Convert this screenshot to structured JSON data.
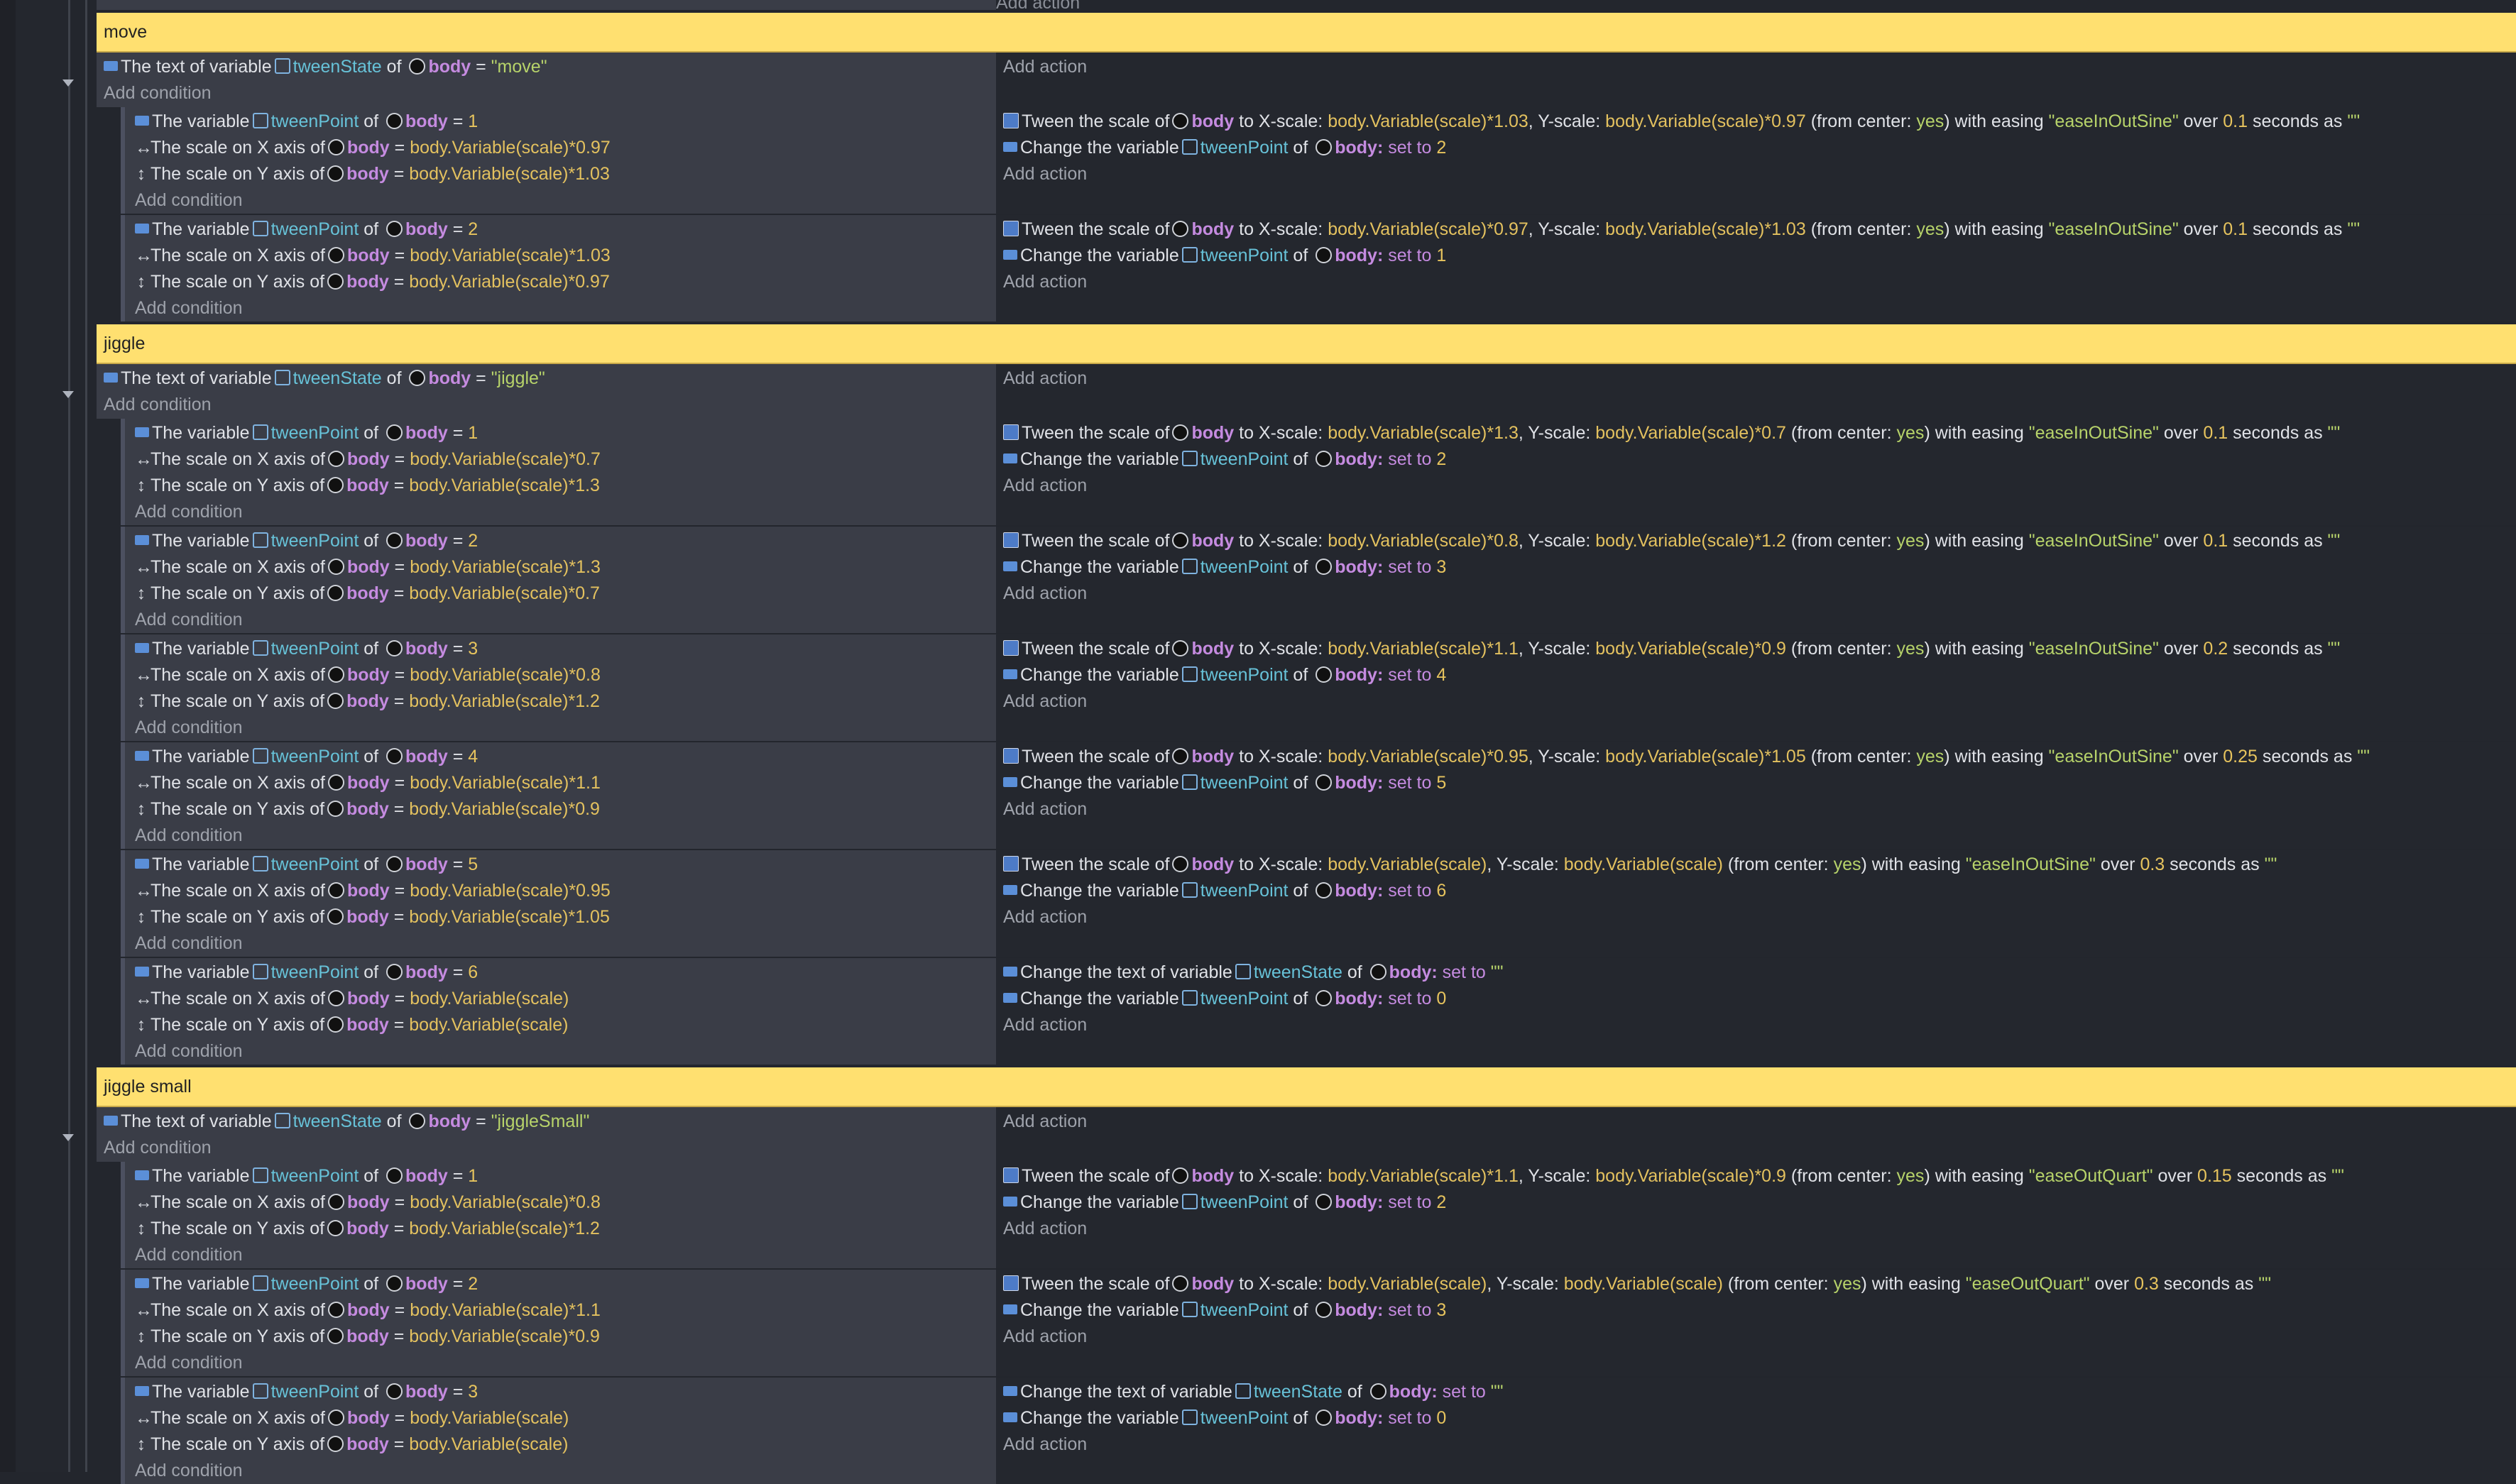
{
  "top_strip": {
    "add_action": "Add action"
  },
  "labels": {
    "add_condition": "Add condition",
    "add_action": "Add action",
    "the_variable": "The variable",
    "the_text_of_variable": "The text of variable",
    "of": "of",
    "scale_x": "The scale on X axis of",
    "scale_y": "The scale on Y axis of",
    "tween_scale": "Tween the scale of",
    "to_x_scale": "to X-scale:",
    "y_scale": "Y-scale:",
    "from_center": "(from center:",
    "yes": "yes",
    "with_easing": ") with easing",
    "over": "over",
    "seconds_as": "seconds as",
    "empty_str": "\"\"",
    "change_var": "Change the variable",
    "change_text_var": "Change the text of variable",
    "set_to": "set to",
    "object": "body",
    "tween_point": "tweenPoint",
    "tween_state": "tweenState",
    "eq": "="
  },
  "groups": [
    {
      "name": "move",
      "state": "\"move\"",
      "subs": [
        {
          "point": "1",
          "sx": "body.Variable(scale)*0.97",
          "sy": "body.Variable(scale)*1.03",
          "tween": {
            "x": "body.Variable(scale)*1.03",
            "y": "body.Variable(scale)*0.97",
            "ease": "\"easeInOutSine\"",
            "dur": "0.1"
          },
          "change_text": null,
          "next": "2"
        },
        {
          "point": "2",
          "sx": "body.Variable(scale)*1.03",
          "sy": "body.Variable(scale)*0.97",
          "tween": {
            "x": "body.Variable(scale)*0.97",
            "y": "body.Variable(scale)*1.03",
            "ease": "\"easeInOutSine\"",
            "dur": "0.1"
          },
          "change_text": null,
          "next": "1"
        }
      ]
    },
    {
      "name": "jiggle",
      "state": "\"jiggle\"",
      "subs": [
        {
          "point": "1",
          "sx": "body.Variable(scale)*0.7",
          "sy": "body.Variable(scale)*1.3",
          "tween": {
            "x": "body.Variable(scale)*1.3",
            "y": "body.Variable(scale)*0.7",
            "ease": "\"easeInOutSine\"",
            "dur": "0.1"
          },
          "change_text": null,
          "next": "2"
        },
        {
          "point": "2",
          "sx": "body.Variable(scale)*1.3",
          "sy": "body.Variable(scale)*0.7",
          "tween": {
            "x": "body.Variable(scale)*0.8",
            "y": "body.Variable(scale)*1.2",
            "ease": "\"easeInOutSine\"",
            "dur": "0.1"
          },
          "change_text": null,
          "next": "3"
        },
        {
          "point": "3",
          "sx": "body.Variable(scale)*0.8",
          "sy": "body.Variable(scale)*1.2",
          "tween": {
            "x": "body.Variable(scale)*1.1",
            "y": "body.Variable(scale)*0.9",
            "ease": "\"easeInOutSine\"",
            "dur": "0.2"
          },
          "change_text": null,
          "next": "4"
        },
        {
          "point": "4",
          "sx": "body.Variable(scale)*1.1",
          "sy": "body.Variable(scale)*0.9",
          "tween": {
            "x": "body.Variable(scale)*0.95",
            "y": "body.Variable(scale)*1.05",
            "ease": "\"easeInOutSine\"",
            "dur": "0.25"
          },
          "change_text": null,
          "next": "5"
        },
        {
          "point": "5",
          "sx": "body.Variable(scale)*0.95",
          "sy": "body.Variable(scale)*1.05",
          "tween": {
            "x": "body.Variable(scale)",
            "y": "body.Variable(scale)",
            "ease": "\"easeInOutSine\"",
            "dur": "0.3"
          },
          "change_text": null,
          "next": "6"
        },
        {
          "point": "6",
          "sx": "body.Variable(scale)",
          "sy": "body.Variable(scale)",
          "tween": null,
          "change_text": "\"\"",
          "next": "0"
        }
      ]
    },
    {
      "name": "jiggle small",
      "state": "\"jiggleSmall\"",
      "subs": [
        {
          "point": "1",
          "sx": "body.Variable(scale)*0.8",
          "sy": "body.Variable(scale)*1.2",
          "tween": {
            "x": "body.Variable(scale)*1.1",
            "y": "body.Variable(scale)*0.9",
            "ease": "\"easeOutQuart\"",
            "dur": "0.15"
          },
          "change_text": null,
          "next": "2"
        },
        {
          "point": "2",
          "sx": "body.Variable(scale)*1.1",
          "sy": "body.Variable(scale)*0.9",
          "tween": {
            "x": "body.Variable(scale)",
            "y": "body.Variable(scale)",
            "ease": "\"easeOutQuart\"",
            "dur": "0.3"
          },
          "change_text": null,
          "next": "3"
        },
        {
          "point": "3",
          "sx": "body.Variable(scale)",
          "sy": "body.Variable(scale)",
          "tween": null,
          "change_text": "\"\"",
          "next": "0"
        }
      ]
    }
  ]
}
